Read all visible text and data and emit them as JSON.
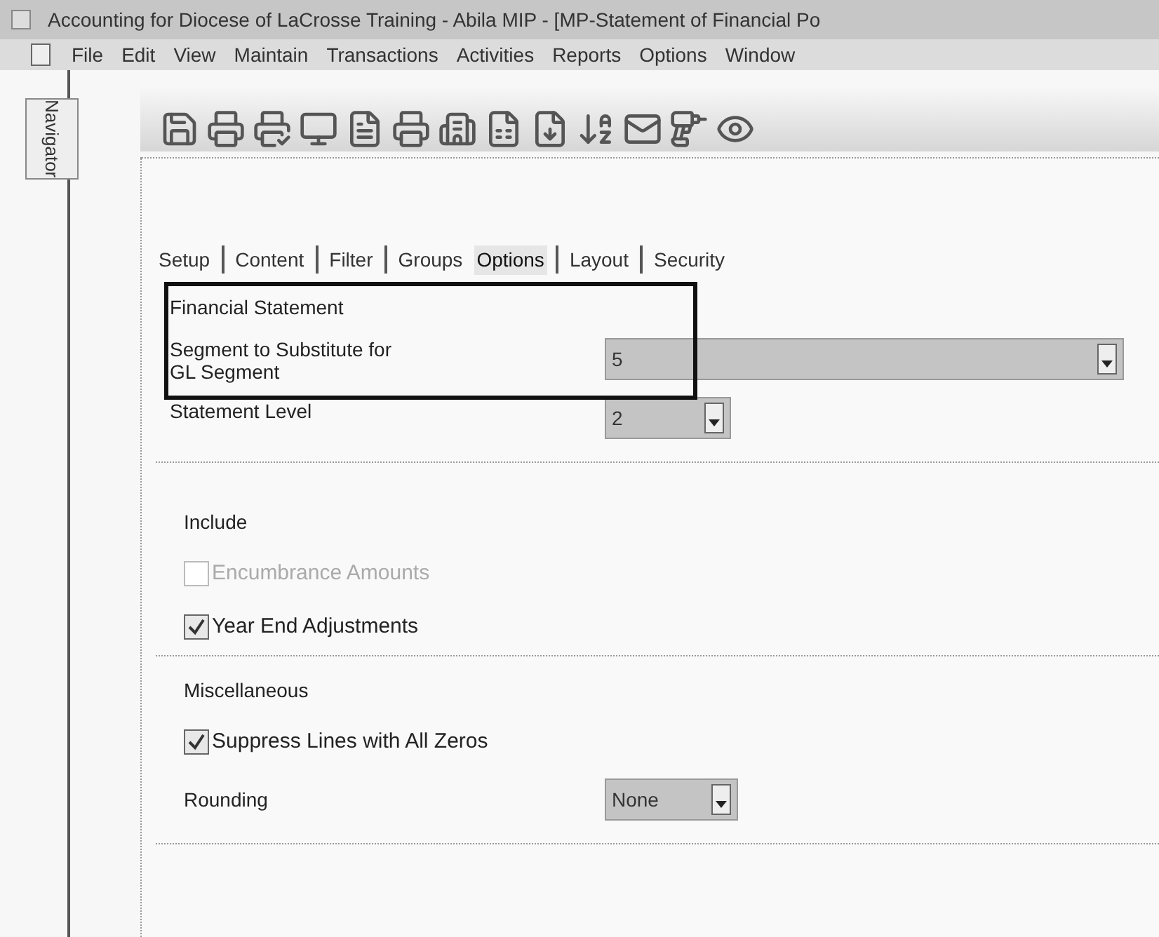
{
  "window": {
    "title": "Accounting for Diocese of LaCrosse Training - Abila MIP - [MP-Statement of Financial Po"
  },
  "menu": [
    "File",
    "Edit",
    "View",
    "Maintain",
    "Transactions",
    "Activities",
    "Reports",
    "Options",
    "Window"
  ],
  "navigator": {
    "label": "Navigator"
  },
  "tabs": [
    {
      "label": "Setup",
      "selected": false
    },
    {
      "label": "Content",
      "selected": false
    },
    {
      "label": "Filter",
      "selected": false
    },
    {
      "label": "Groups",
      "selected": false
    },
    {
      "label": "Options",
      "selected": true
    },
    {
      "label": "Layout",
      "selected": false
    },
    {
      "label": "Security",
      "selected": false
    }
  ],
  "financial_statement": {
    "title": "Financial Statement",
    "segment": {
      "label": "Segment to Substitute for GL Segment",
      "value": "5"
    },
    "statement_level": {
      "label": "Statement Level",
      "value": "2"
    }
  },
  "include": {
    "title": "Include",
    "checkboxes": [
      {
        "label": "Encumbrance Amounts",
        "checked": false,
        "disabled": true
      },
      {
        "label": "Year End Adjustments",
        "checked": true,
        "disabled": false
      }
    ]
  },
  "miscellaneous": {
    "title": "Miscellaneous",
    "checkboxes": [
      {
        "label": "Suppress Lines with All Zeros",
        "checked": true,
        "disabled": false
      }
    ],
    "rounding": {
      "label": "Rounding",
      "value": "None"
    }
  }
}
